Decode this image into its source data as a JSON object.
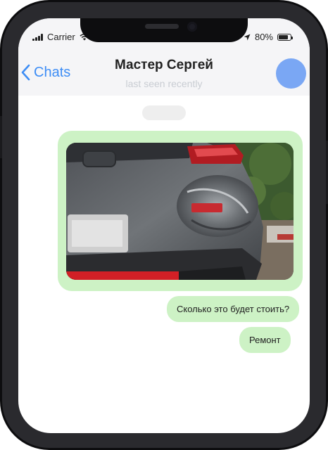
{
  "status_bar": {
    "carrier": "Carrier",
    "battery": "80%",
    "battery_level": 0.8
  },
  "header": {
    "back_label": "Chats",
    "contact_name": "Мастер Сергей",
    "last_seen": "last seen recently"
  },
  "messages": [
    {
      "type": "image",
      "description": "damaged car rear bumper"
    },
    {
      "type": "text",
      "text": "Сколько это будет стоить?"
    },
    {
      "type": "text",
      "text": "Ремонт"
    }
  ],
  "colors": {
    "accent": "#3d8df5",
    "bubble_out": "#cdf2c5",
    "avatar": "#7aa7f4"
  }
}
